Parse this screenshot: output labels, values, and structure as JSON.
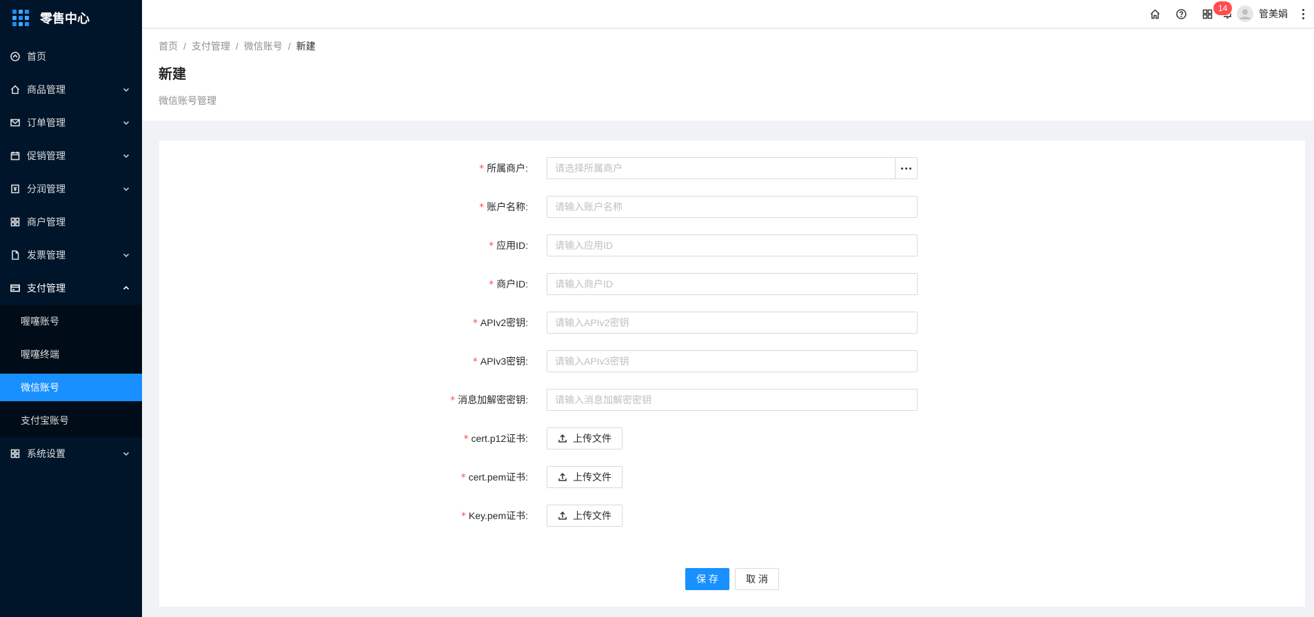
{
  "app": {
    "title": "零售中心"
  },
  "sidebar": {
    "items": [
      {
        "label": "首页",
        "icon": "dashboard-icon",
        "has_children": false
      },
      {
        "label": "商品管理",
        "icon": "home-icon",
        "has_children": true
      },
      {
        "label": "订单管理",
        "icon": "mail-icon",
        "has_children": true
      },
      {
        "label": "促销管理",
        "icon": "calendar-icon",
        "has_children": true
      },
      {
        "label": "分润管理",
        "icon": "money-icon",
        "has_children": true
      },
      {
        "label": "商户管理",
        "icon": "appstore-icon",
        "has_children": false
      },
      {
        "label": "发票管理",
        "icon": "file-icon",
        "has_children": true
      },
      {
        "label": "支付管理",
        "icon": "credit-card-icon",
        "has_children": true,
        "expanded": true
      },
      {
        "label": "系统设置",
        "icon": "appstore-icon",
        "has_children": true
      }
    ],
    "payment_submenu": [
      {
        "label": "喔噻账号",
        "active": false
      },
      {
        "label": "喔噻终端",
        "active": false
      },
      {
        "label": "微信账号",
        "active": true
      },
      {
        "label": "支付宝账号",
        "active": false
      }
    ]
  },
  "header": {
    "notification_count": "14",
    "user_name": "管美娟",
    "icons": [
      "home-icon",
      "question-icon",
      "appstore-icon",
      "bell-icon"
    ]
  },
  "breadcrumb": {
    "items": [
      "首页",
      "支付管理",
      "微信账号",
      "新建"
    ]
  },
  "page": {
    "title": "新建",
    "description": "微信账号管理"
  },
  "form": {
    "fields": [
      {
        "label": "所属商户",
        "required": true,
        "type": "select-picker",
        "placeholder": "请选择所属商户",
        "value": ""
      },
      {
        "label": "账户名称",
        "required": true,
        "type": "text",
        "placeholder": "请输入账户名称",
        "value": ""
      },
      {
        "label": "应用ID",
        "required": true,
        "type": "text",
        "placeholder": "请输入应用ID",
        "value": ""
      },
      {
        "label": "商户ID",
        "required": true,
        "type": "text",
        "placeholder": "请输入商户ID",
        "value": ""
      },
      {
        "label": "APIv2密钥",
        "required": true,
        "type": "text",
        "placeholder": "请输入APIv2密钥",
        "value": ""
      },
      {
        "label": "APIv3密钥",
        "required": true,
        "type": "text",
        "placeholder": "请输入APIv3密钥",
        "value": ""
      },
      {
        "label": "消息加解密密钥",
        "required": true,
        "type": "text",
        "placeholder": "请输入消息加解密密钥",
        "value": ""
      },
      {
        "label": "cert.p12证书",
        "required": true,
        "type": "upload",
        "button_label": "上传文件"
      },
      {
        "label": "cert.pem证书",
        "required": true,
        "type": "upload",
        "button_label": "上传文件"
      },
      {
        "label": "Key.pem证书",
        "required": true,
        "type": "upload",
        "button_label": "上传文件"
      }
    ],
    "label_suffix": ":",
    "save_label": "保存",
    "cancel_label": "取消"
  },
  "colors": {
    "sidebar_bg": "#001529",
    "submenu_bg": "#000c17",
    "primary": "#1890ff",
    "required": "#ff4d4f",
    "badge": "#ff4d4f"
  }
}
